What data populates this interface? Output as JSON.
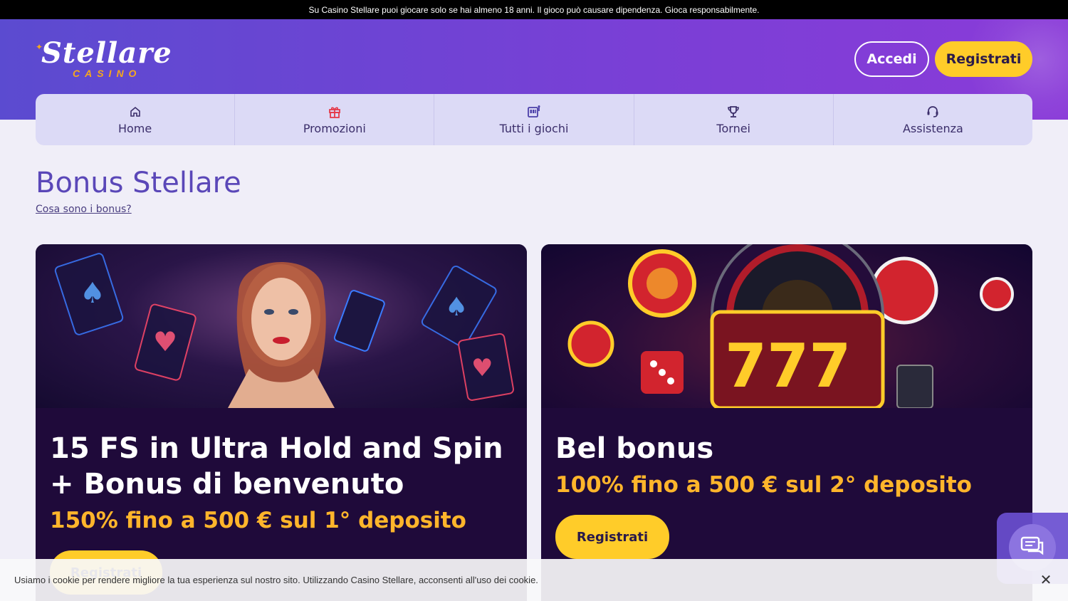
{
  "notice": "Su Casino Stellare puoi giocare solo se hai almeno 18 anni. Il gioco può causare dipendenza. Gioca responsabilmente.",
  "logo": {
    "main": "Stellare",
    "sub": "CASINO"
  },
  "header": {
    "login_label": "Accedi",
    "register_label": "Registrati"
  },
  "nav": [
    {
      "label": "Home",
      "icon": "home-icon"
    },
    {
      "label": "Promozioni",
      "icon": "gift-icon"
    },
    {
      "label": "Tutti i giochi",
      "icon": "slot-machine-icon"
    },
    {
      "label": "Tornei",
      "icon": "trophy-icon"
    },
    {
      "label": "Assistenza",
      "icon": "headset-icon"
    }
  ],
  "page": {
    "title": "Bonus Stellare",
    "link": "Cosa sono i bonus?"
  },
  "cards": [
    {
      "title": "15 FS in Ultra Hold and Spin + Bonus di benvenuto",
      "subtitle": "150% fino a 500 € sul 1° deposito",
      "button": "Registrati"
    },
    {
      "title": "Bel bonus",
      "subtitle": "100% fino a 500 € sul 2° deposito",
      "button": "Registrati"
    }
  ],
  "cookie": {
    "text": "Usiamo i cookie per rendere migliore la tua esperienza sul nostro sito. Utilizzando Casino Stellare, acconsenti all'uso dei cookie."
  },
  "colors": {
    "accent": "#ffcc29",
    "brand_purple": "#6b45d4",
    "highlight": "#ffb52b",
    "card_bg": "#1f0a3a"
  }
}
